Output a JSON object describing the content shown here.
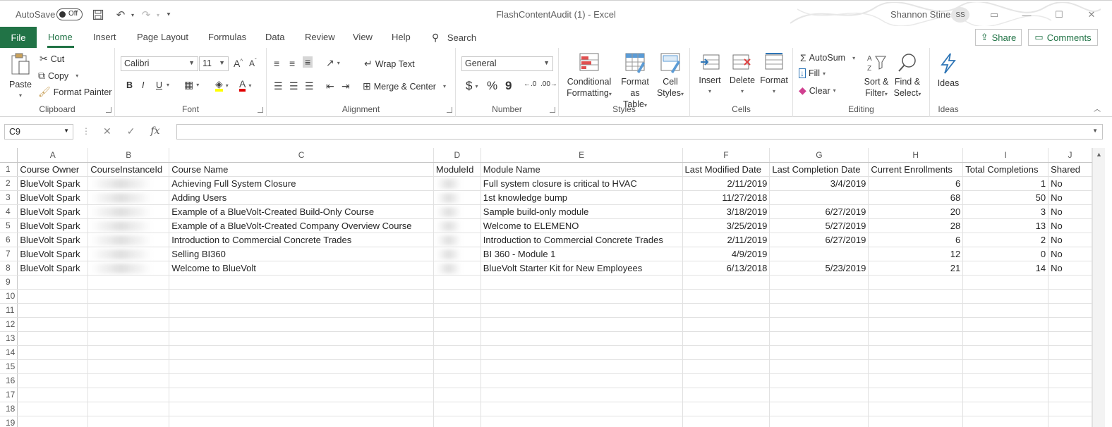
{
  "titlebar": {
    "autosave_label": "AutoSave",
    "autosave_state": "Off",
    "title": "FlashContentAudit (1)  -  Excel",
    "user_name": "Shannon Stine",
    "user_initials": "SS"
  },
  "tabs": {
    "file": "File",
    "items": [
      "Home",
      "Insert",
      "Page Layout",
      "Formulas",
      "Data",
      "Review",
      "View",
      "Help"
    ],
    "search": "Search",
    "share": "Share",
    "comments": "Comments"
  },
  "ribbon": {
    "clipboard": {
      "label": "Clipboard",
      "paste": "Paste",
      "cut": "Cut",
      "copy": "Copy",
      "format_painter": "Format Painter"
    },
    "font": {
      "label": "Font",
      "font_name": "Calibri",
      "font_size": "11",
      "bold": "B",
      "italic": "I",
      "underline": "U"
    },
    "alignment": {
      "label": "Alignment",
      "wrap_text": "Wrap Text",
      "merge_center": "Merge & Center"
    },
    "number": {
      "label": "Number",
      "format": "General",
      "currency": "$",
      "percent": "%",
      "comma": "9"
    },
    "styles": {
      "label": "Styles",
      "conditional": "Conditional",
      "formatting": "Formatting",
      "format_as": "Format as",
      "table": "Table",
      "cell": "Cell",
      "styles_btn": "Styles"
    },
    "cells": {
      "label": "Cells",
      "insert": "Insert",
      "delete": "Delete",
      "format": "Format"
    },
    "editing": {
      "label": "Editing",
      "autosum": "AutoSum",
      "fill": "Fill",
      "clear": "Clear",
      "sort": "Sort &",
      "filter": "Filter",
      "find": "Find &",
      "select": "Select"
    },
    "ideas": {
      "label": "Ideas",
      "ideas_btn": "Ideas"
    }
  },
  "formula_bar": {
    "name_box": "C9",
    "fx": "fx",
    "formula": ""
  },
  "sheet": {
    "columns": [
      "A",
      "B",
      "C",
      "D",
      "E",
      "F",
      "G",
      "H",
      "I",
      "J"
    ],
    "row_numbers": [
      "1",
      "2",
      "3",
      "4",
      "5",
      "6",
      "7",
      "8",
      "9",
      "10",
      "11",
      "12",
      "13",
      "14",
      "15",
      "16",
      "17",
      "18",
      "19"
    ],
    "headers": [
      "Course Owner",
      "CourseInstanceId",
      "Course Name",
      "ModuleId",
      "Module Name",
      "Last Modified Date",
      "Last Completion Date",
      "Current Enrollments",
      "Total Completions",
      "Shared"
    ],
    "rows": [
      [
        "BlueVolt Spark",
        "",
        "Achieving Full System Closure",
        "",
        "Full system closure is critical to HVAC",
        "2/11/2019",
        "3/4/2019",
        "6",
        "1",
        "No"
      ],
      [
        "BlueVolt Spark",
        "",
        "Adding Users",
        "",
        "1st knowledge bump",
        "11/27/2018",
        "",
        "68",
        "50",
        "No"
      ],
      [
        "BlueVolt Spark",
        "",
        "Example of a BlueVolt-Created Build-Only Course",
        "",
        "Sample build-only module",
        "3/18/2019",
        "6/27/2019",
        "20",
        "3",
        "No"
      ],
      [
        "BlueVolt Spark",
        "",
        "Example of a BlueVolt-Created Company Overview Course",
        "",
        "Welcome to ELEMENO",
        "3/25/2019",
        "5/27/2019",
        "28",
        "13",
        "No"
      ],
      [
        "BlueVolt Spark",
        "",
        "Introduction to Commercial Concrete Trades",
        "",
        "Introduction to Commercial Concrete Trades",
        "2/11/2019",
        "6/27/2019",
        "6",
        "2",
        "No"
      ],
      [
        "BlueVolt Spark",
        "",
        "Selling BI360",
        "",
        "BI 360 - Module 1",
        "4/9/2019",
        "",
        "12",
        "0",
        "No"
      ],
      [
        "BlueVolt Spark",
        "",
        "Welcome to BlueVolt",
        "",
        "BlueVolt Starter Kit for New Employees",
        "6/13/2018",
        "5/23/2019",
        "21",
        "14",
        "No"
      ]
    ]
  },
  "colors": {
    "accent": "#217346"
  }
}
